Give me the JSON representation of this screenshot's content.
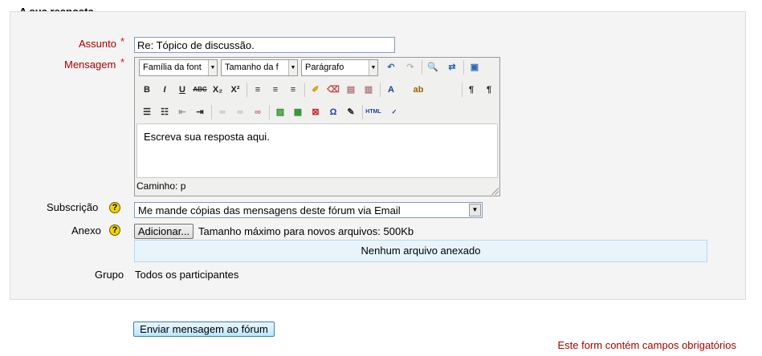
{
  "form": {
    "legend": "A sua resposta",
    "subject_label": "Assunto",
    "subject_value": "Re: Tópico de discussão.",
    "message_label": "Mensagem",
    "required_star": "*",
    "subscription_label": "Subscrição",
    "subscription_value": "Me mande cópias das mensagens deste fórum via Email",
    "attachment_label": "Anexo",
    "add_button": "Adicionar...",
    "max_size_text": "Tamanho máximo para novos arquivos: 500Kb",
    "no_attachment_text": "Nenhum arquivo anexado",
    "group_label": "Grupo",
    "group_value": "Todos os participantes",
    "submit_button": "Enviar mensagem ao fórum",
    "required_note": "Este form contém campos obrigatórios",
    "help_glyph": "?"
  },
  "editor": {
    "font_family": "Família da font",
    "font_size": "Tamanho da f",
    "format": "Parágrafo",
    "content": "Escreva sua resposta aqui.",
    "path_label": "Caminho: p",
    "buttons_row2": [
      "B",
      "I",
      "U",
      "ABC",
      "X₂",
      "X²"
    ],
    "icons": [
      "undo-icon",
      "redo-icon",
      "find-icon",
      "replace-icon",
      "fullscreen-icon"
    ]
  },
  "colors": {
    "required": "#aa0000",
    "star": "#ff0000",
    "dropzone": "#e8f4fc",
    "help": "#f3d400"
  }
}
